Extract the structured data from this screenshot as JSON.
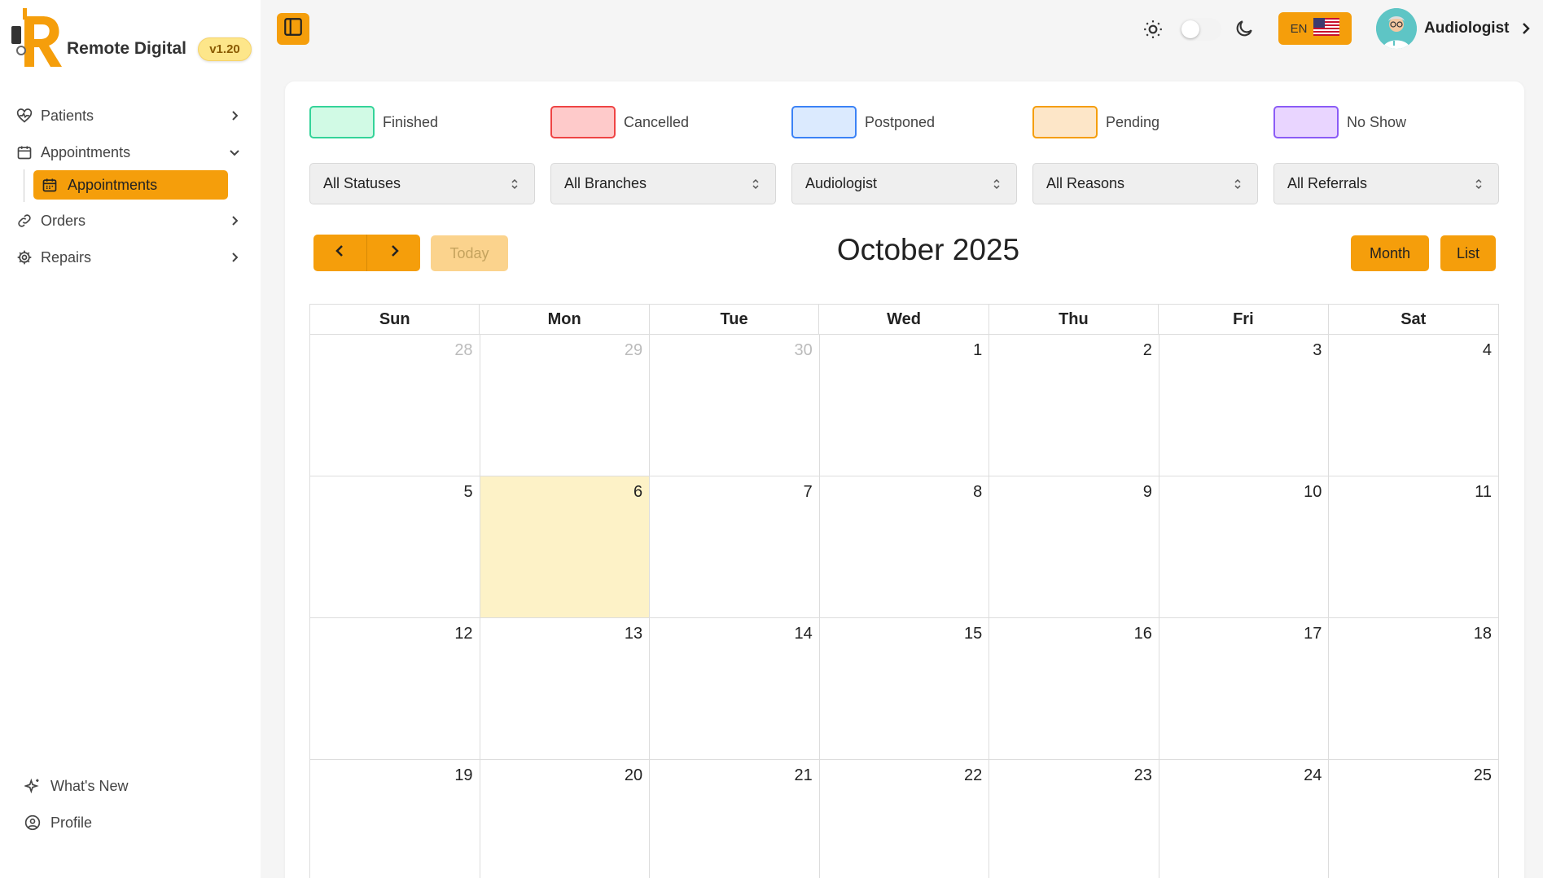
{
  "sidebar": {
    "brand": "Remote Digital",
    "version": "v1.20",
    "nav": [
      {
        "label": "Patients",
        "icon": "heart-pulse-icon"
      },
      {
        "label": "Appointments",
        "icon": "calendar-icon",
        "expanded": true
      },
      {
        "label": "Orders",
        "icon": "link-icon"
      },
      {
        "label": "Repairs",
        "icon": "gear-icon"
      }
    ],
    "active_sub": "Appointments",
    "bottom": [
      {
        "label": "What's New",
        "icon": "sparkles-icon"
      },
      {
        "label": "Profile",
        "icon": "user-circle-icon"
      }
    ]
  },
  "topbar": {
    "lang": "EN",
    "user": "Audiologist"
  },
  "legend": [
    {
      "label": "Finished",
      "border": "#34d399",
      "fill": "#d1fae5"
    },
    {
      "label": "Cancelled",
      "border": "#ef4444",
      "fill": "#fecaca"
    },
    {
      "label": "Postponed",
      "border": "#3b82f6",
      "fill": "#dbeafe"
    },
    {
      "label": "Pending",
      "border": "#f59e0b",
      "fill": "#fde6c8"
    },
    {
      "label": "No Show",
      "border": "#8b5cf6",
      "fill": "#e9d5ff"
    }
  ],
  "filters": [
    "All Statuses",
    "All Branches",
    "Audiologist",
    "All Reasons",
    "All Referrals"
  ],
  "calendar": {
    "today_label": "Today",
    "title": "October 2025",
    "month_label": "Month",
    "list_label": "List",
    "weekdays": [
      "Sun",
      "Mon",
      "Tue",
      "Wed",
      "Thu",
      "Fri",
      "Sat"
    ],
    "weeks": [
      [
        {
          "d": "28",
          "o": true
        },
        {
          "d": "29",
          "o": true
        },
        {
          "d": "30",
          "o": true
        },
        {
          "d": "1"
        },
        {
          "d": "2"
        },
        {
          "d": "3"
        },
        {
          "d": "4"
        }
      ],
      [
        {
          "d": "5"
        },
        {
          "d": "6",
          "t": true
        },
        {
          "d": "7"
        },
        {
          "d": "8"
        },
        {
          "d": "9"
        },
        {
          "d": "10"
        },
        {
          "d": "11"
        }
      ],
      [
        {
          "d": "12"
        },
        {
          "d": "13"
        },
        {
          "d": "14"
        },
        {
          "d": "15"
        },
        {
          "d": "16"
        },
        {
          "d": "17"
        },
        {
          "d": "18"
        }
      ],
      [
        {
          "d": "19"
        },
        {
          "d": "20"
        },
        {
          "d": "21"
        },
        {
          "d": "22"
        },
        {
          "d": "23"
        },
        {
          "d": "24"
        },
        {
          "d": "25"
        }
      ]
    ]
  },
  "colors": {
    "accent": "#f59e0b",
    "today_bg": "#fdf2c7"
  }
}
